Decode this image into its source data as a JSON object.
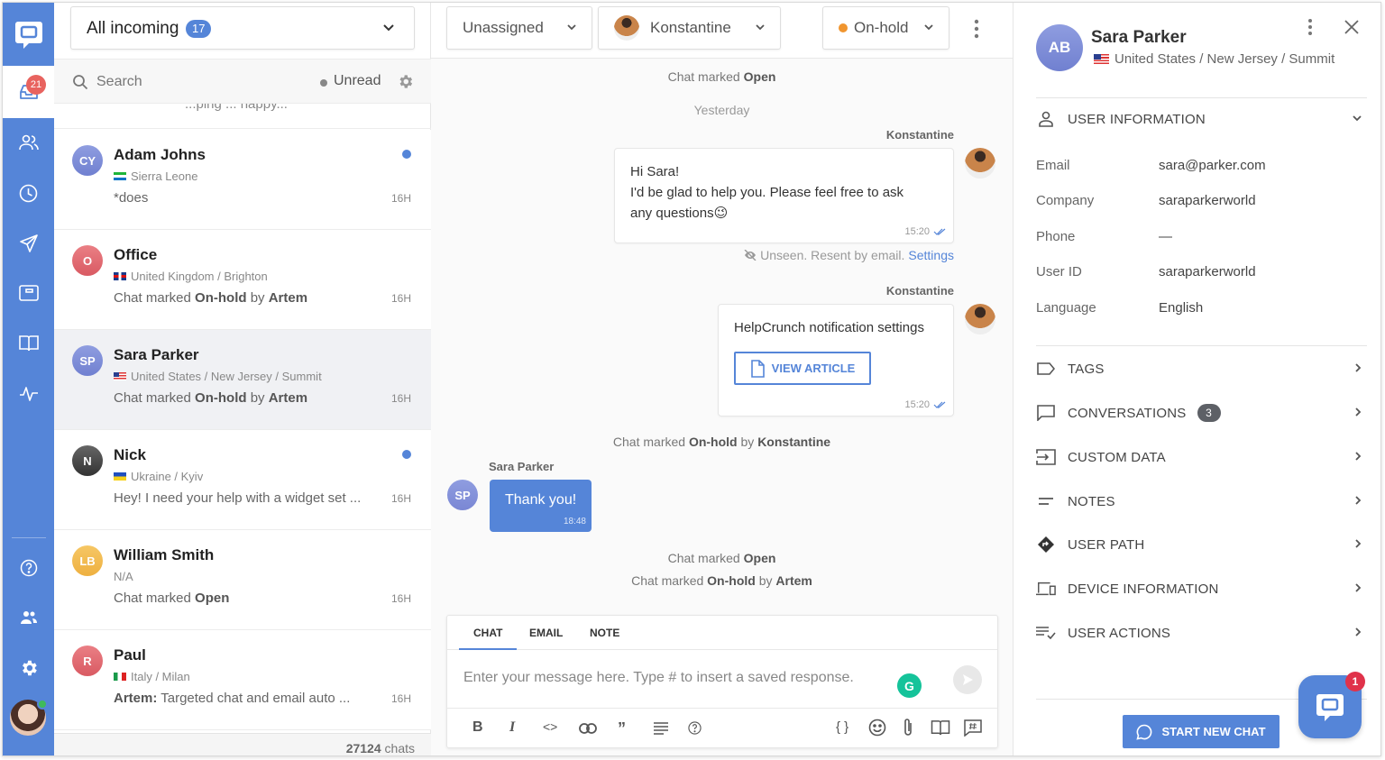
{
  "nav": {
    "inbox_badge": "21",
    "items": [
      "inbox",
      "contacts",
      "history",
      "campaigns",
      "widget",
      "knowledge-base",
      "activity",
      "help",
      "team",
      "settings"
    ]
  },
  "list": {
    "filter_label": "All incoming",
    "filter_count": "17",
    "search_placeholder": "Search",
    "unread_label": "Unread",
    "partial_text": "...ping ... happy...",
    "conversations": [
      {
        "initials": "CY",
        "name": "Adam Johns",
        "location": "Sierra Leone",
        "message": "*does",
        "time": "16H",
        "unread": true,
        "color": "#7c88d6"
      },
      {
        "initials": "O",
        "name": "Office",
        "location": "United Kingdom / Brighton",
        "message_pre": "Chat marked ",
        "message_b1": "On-hold",
        "message_mid": " by ",
        "message_b2": "Artem",
        "time": "16H",
        "unread": false,
        "color": "#e06b72"
      },
      {
        "initials": "SP",
        "name": "Sara Parker",
        "location": "United States / New Jersey / Summit",
        "message_pre": "Chat marked ",
        "message_b1": "On-hold",
        "message_mid": " by ",
        "message_b2": "Artem",
        "time": "16H",
        "unread": false,
        "selected": true,
        "color": "#7c88d6"
      },
      {
        "initials": "N",
        "name": "Nick",
        "location": "Ukraine / Kyiv",
        "message": "Hey! I need your help with a widget set ...",
        "time": "16H",
        "unread": true,
        "color": "#555555"
      },
      {
        "initials": "LB",
        "name": "William Smith",
        "location": "N/A",
        "message_pre": "Chat marked ",
        "message_b1": "Open",
        "time": "16H",
        "unread": false,
        "color": "#f0b94a"
      },
      {
        "initials": "R",
        "name": "Paul",
        "location": "Italy / Milan",
        "message_b0": "Artem:",
        "message": " Targeted chat and email auto ...",
        "time": "16H",
        "unread": false,
        "color": "#e06b72"
      }
    ],
    "total_count": "27124",
    "total_suffix": " chats"
  },
  "chat": {
    "assign_team": "Unassigned",
    "assign_agent": "Konstantine",
    "status": "On-hold",
    "status_color": "#f0952f",
    "events": {
      "marked_open_1_pre": "Chat marked ",
      "marked_open_1_b": "Open",
      "day_label": "Yesterday",
      "onhold_konst_pre": "Chat marked ",
      "onhold_konst_b1": "On-hold",
      "onhold_konst_mid": " by ",
      "onhold_konst_b2": "Konstantine",
      "marked_open_2_pre": "Chat marked ",
      "marked_open_2_b": "Open",
      "onhold_artem_pre": "Chat marked ",
      "onhold_artem_b1": "On-hold",
      "onhold_artem_mid": " by ",
      "onhold_artem_b2": "Artem"
    },
    "messages": [
      {
        "sender": "Konstantine",
        "line1": "Hi Sara!",
        "line2": "I'd be glad to help you. Please feel free to ask",
        "line3": "any questions😉",
        "time": "15:20"
      },
      {
        "sender": "Konstantine",
        "text": "HelpCrunch notification settings",
        "button": "VIEW ARTICLE",
        "time": "15:20"
      },
      {
        "sender": "Sara Parker",
        "initials": "SP",
        "text": "Thank you!",
        "time": "18:48"
      }
    ],
    "unseen_note": "Unseen. Resent by email.",
    "unseen_link": "Settings",
    "composer": {
      "tabs": [
        "CHAT",
        "EMAIL",
        "NOTE"
      ],
      "active_tab": "CHAT",
      "placeholder": "Enter your message here. Type # to insert a saved response.",
      "grammarly": "G"
    }
  },
  "profile": {
    "initials": "AB",
    "name": "Sara Parker",
    "location": "United States / New Jersey / Summit",
    "user_info_title": "USER INFORMATION",
    "fields": [
      {
        "label": "Email",
        "value": "sara@parker.com"
      },
      {
        "label": "Company",
        "value": "saraparkerworld"
      },
      {
        "label": "Phone",
        "value": "—"
      },
      {
        "label": "User ID",
        "value": "saraparkerworld"
      },
      {
        "label": "Language",
        "value": "English"
      }
    ],
    "sections": [
      {
        "label": "TAGS"
      },
      {
        "label": "CONVERSATIONS",
        "badge": "3"
      },
      {
        "label": "CUSTOM DATA"
      },
      {
        "label": "NOTES"
      },
      {
        "label": "USER PATH"
      },
      {
        "label": "DEVICE INFORMATION"
      },
      {
        "label": "USER ACTIONS"
      }
    ],
    "start_chat": "START NEW CHAT",
    "widget_badge": "1"
  }
}
